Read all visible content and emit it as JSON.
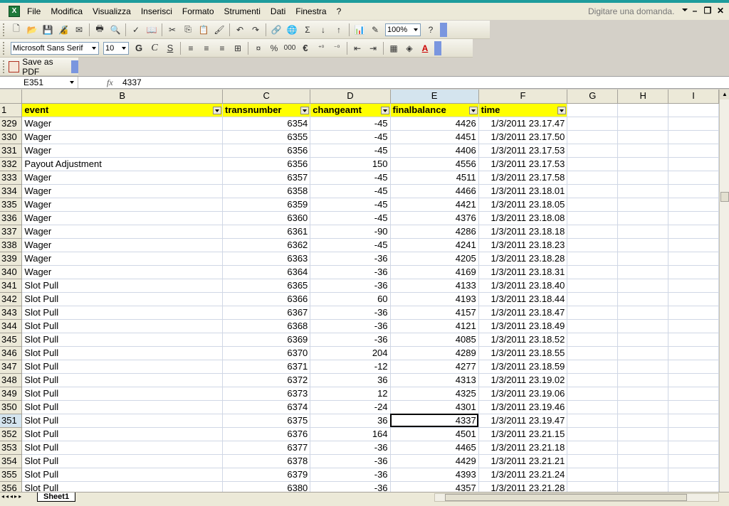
{
  "menu": {
    "items": [
      "File",
      "Modifica",
      "Visualizza",
      "Inserisci",
      "Formato",
      "Strumenti",
      "Dati",
      "Finestra",
      "?"
    ],
    "ask_placeholder": "Digitare una domanda."
  },
  "toolbar_standard": {
    "zoom": "100%",
    "icons": [
      "new-icon",
      "open-icon",
      "save-icon",
      "permission-icon",
      "print-icon",
      "print-preview-icon",
      "spelling-icon",
      "research-icon",
      "cut-icon",
      "copy-icon",
      "paste-icon",
      "format-painter-icon",
      "undo-icon",
      "redo-icon",
      "hyperlink-icon",
      "autosum-icon",
      "sort-ascending-icon",
      "sort-descending-icon",
      "chart-wizard-icon",
      "drawing-icon",
      "help-icon"
    ]
  },
  "toolbar_format": {
    "font": "Microsoft Sans Serif",
    "size": "10",
    "bold": "G",
    "italic": "C",
    "underline": "S",
    "percent": "%",
    "thousands": "000",
    "euro": "€"
  },
  "toolbar_pdf": {
    "label": "Save as PDF"
  },
  "formula_bar": {
    "name_box": "E351",
    "fx": "fx",
    "value": "4337"
  },
  "columns": [
    "B",
    "C",
    "D",
    "E",
    "F",
    "G",
    "H",
    "I"
  ],
  "header_row": {
    "row": "1",
    "cells": [
      "event",
      "transnumber",
      "changeamt",
      "finalbalance",
      "time"
    ]
  },
  "rows": [
    {
      "r": "329",
      "event": "Wager",
      "trans": "6354",
      "change": "-45",
      "balance": "4426",
      "time": "1/3/2011 23.17.47"
    },
    {
      "r": "330",
      "event": "Wager",
      "trans": "6355",
      "change": "-45",
      "balance": "4451",
      "time": "1/3/2011 23.17.50"
    },
    {
      "r": "331",
      "event": "Wager",
      "trans": "6356",
      "change": "-45",
      "balance": "4406",
      "time": "1/3/2011 23.17.53"
    },
    {
      "r": "332",
      "event": "Payout Adjustment",
      "trans": "6356",
      "change": "150",
      "balance": "4556",
      "time": "1/3/2011 23.17.53"
    },
    {
      "r": "333",
      "event": "Wager",
      "trans": "6357",
      "change": "-45",
      "balance": "4511",
      "time": "1/3/2011 23.17.58"
    },
    {
      "r": "334",
      "event": "Wager",
      "trans": "6358",
      "change": "-45",
      "balance": "4466",
      "time": "1/3/2011 23.18.01"
    },
    {
      "r": "335",
      "event": "Wager",
      "trans": "6359",
      "change": "-45",
      "balance": "4421",
      "time": "1/3/2011 23.18.05"
    },
    {
      "r": "336",
      "event": "Wager",
      "trans": "6360",
      "change": "-45",
      "balance": "4376",
      "time": "1/3/2011 23.18.08"
    },
    {
      "r": "337",
      "event": "Wager",
      "trans": "6361",
      "change": "-90",
      "balance": "4286",
      "time": "1/3/2011 23.18.18"
    },
    {
      "r": "338",
      "event": "Wager",
      "trans": "6362",
      "change": "-45",
      "balance": "4241",
      "time": "1/3/2011 23.18.23"
    },
    {
      "r": "339",
      "event": "Wager",
      "trans": "6363",
      "change": "-36",
      "balance": "4205",
      "time": "1/3/2011 23.18.28"
    },
    {
      "r": "340",
      "event": "Wager",
      "trans": "6364",
      "change": "-36",
      "balance": "4169",
      "time": "1/3/2011 23.18.31"
    },
    {
      "r": "341",
      "event": "Slot Pull",
      "trans": "6365",
      "change": "-36",
      "balance": "4133",
      "time": "1/3/2011 23.18.40"
    },
    {
      "r": "342",
      "event": "Slot Pull",
      "trans": "6366",
      "change": "60",
      "balance": "4193",
      "time": "1/3/2011 23.18.44"
    },
    {
      "r": "343",
      "event": "Slot Pull",
      "trans": "6367",
      "change": "-36",
      "balance": "4157",
      "time": "1/3/2011 23.18.47"
    },
    {
      "r": "344",
      "event": "Slot Pull",
      "trans": "6368",
      "change": "-36",
      "balance": "4121",
      "time": "1/3/2011 23.18.49"
    },
    {
      "r": "345",
      "event": "Slot Pull",
      "trans": "6369",
      "change": "-36",
      "balance": "4085",
      "time": "1/3/2011 23.18.52"
    },
    {
      "r": "346",
      "event": "Slot Pull",
      "trans": "6370",
      "change": "204",
      "balance": "4289",
      "time": "1/3/2011 23.18.55"
    },
    {
      "r": "347",
      "event": "Slot Pull",
      "trans": "6371",
      "change": "-12",
      "balance": "4277",
      "time": "1/3/2011 23.18.59"
    },
    {
      "r": "348",
      "event": "Slot Pull",
      "trans": "6372",
      "change": "36",
      "balance": "4313",
      "time": "1/3/2011 23.19.02"
    },
    {
      "r": "349",
      "event": "Slot Pull",
      "trans": "6373",
      "change": "12",
      "balance": "4325",
      "time": "1/3/2011 23.19.06"
    },
    {
      "r": "350",
      "event": "Slot Pull",
      "trans": "6374",
      "change": "-24",
      "balance": "4301",
      "time": "1/3/2011 23.19.46"
    },
    {
      "r": "351",
      "event": "Slot Pull",
      "trans": "6375",
      "change": "36",
      "balance": "4337",
      "time": "1/3/2011 23.19.47"
    },
    {
      "r": "352",
      "event": "Slot Pull",
      "trans": "6376",
      "change": "164",
      "balance": "4501",
      "time": "1/3/2011 23.21.15"
    },
    {
      "r": "353",
      "event": "Slot Pull",
      "trans": "6377",
      "change": "-36",
      "balance": "4465",
      "time": "1/3/2011 23.21.18"
    },
    {
      "r": "354",
      "event": "Slot Pull",
      "trans": "6378",
      "change": "-36",
      "balance": "4429",
      "time": "1/3/2011 23.21.21"
    },
    {
      "r": "355",
      "event": "Slot Pull",
      "trans": "6379",
      "change": "-36",
      "balance": "4393",
      "time": "1/3/2011 23.21.24"
    },
    {
      "r": "356",
      "event": "Slot Pull",
      "trans": "6380",
      "change": "-36",
      "balance": "4357",
      "time": "1/3/2011 23.21.28"
    }
  ],
  "active_row": "351",
  "selected_column": "E",
  "sheet_tabs": [
    "Sheet1"
  ],
  "colors": {
    "header_fill": "#ffff00",
    "selection_header": "#d4e4ee",
    "title_stripe": "#1e9c9c"
  }
}
